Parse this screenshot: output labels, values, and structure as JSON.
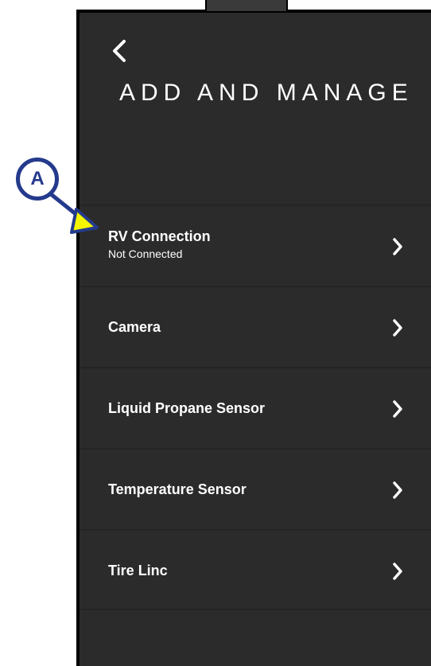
{
  "header": {
    "back_icon": "chevron-left-icon",
    "title": "ADD AND MANAGE"
  },
  "menu": {
    "items": [
      {
        "label": "RV Connection",
        "sublabel": "Not Connected",
        "icon": "chevron-right-icon"
      },
      {
        "label": "Camera",
        "icon": "chevron-right-icon"
      },
      {
        "label": "Liquid Propane Sensor",
        "icon": "chevron-right-icon"
      },
      {
        "label": "Temperature Sensor",
        "icon": "chevron-right-icon"
      },
      {
        "label": "Tire Linc",
        "icon": "chevron-right-icon"
      }
    ]
  },
  "annotation": {
    "label": "A",
    "colors": {
      "ring": "#243a8c",
      "arrow_fill": "#f5f500"
    }
  },
  "colors": {
    "background": "#2b2b2b",
    "text": "#ffffff"
  }
}
